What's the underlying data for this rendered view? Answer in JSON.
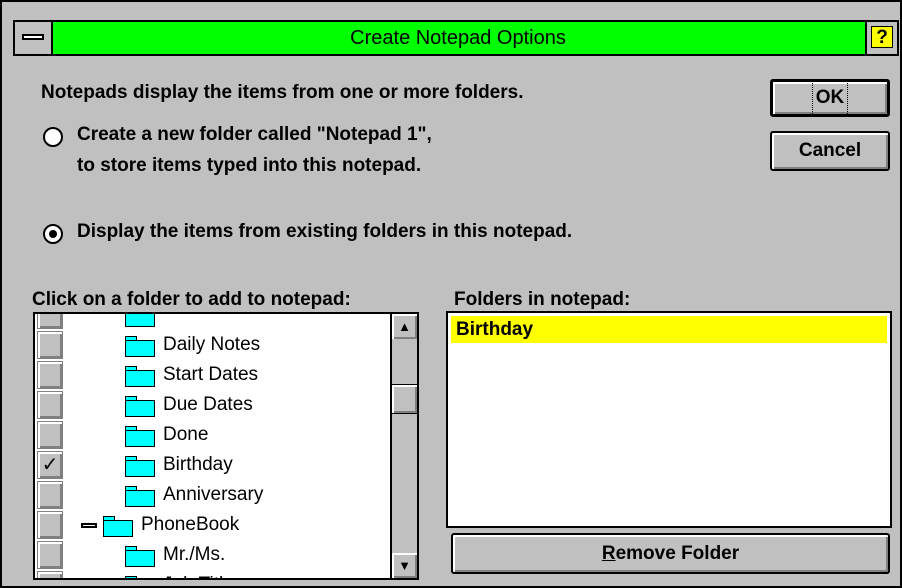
{
  "dialog": {
    "title": "Create Notepad Options",
    "help_label": "?",
    "intro": "Notepads display the items from one or more folders.",
    "option_new_line1": "Create a new folder called \"Notepad 1\",",
    "option_new_line2": "to store items typed into this notepad.",
    "option_existing": "Display the items from existing folders in this notepad.",
    "selected_option": "existing",
    "ok_label": "OK",
    "cancel_label": "Cancel"
  },
  "tree": {
    "header": "Click on a folder to add to notepad:",
    "items": [
      {
        "label": "",
        "checked": false,
        "icon": "folder-icon"
      },
      {
        "label": "Daily Notes",
        "checked": false,
        "icon": "folder-icon"
      },
      {
        "label": "Start Dates",
        "checked": false,
        "icon": "folder-icon"
      },
      {
        "label": "Due Dates",
        "checked": false,
        "icon": "folder-icon"
      },
      {
        "label": "Done",
        "checked": false,
        "icon": "folder-icon"
      },
      {
        "label": "Birthday",
        "checked": true,
        "check_mark": "✓",
        "icon": "folder-icon"
      },
      {
        "label": "Anniversary",
        "checked": false,
        "icon": "folder-icon"
      },
      {
        "label": "PhoneBook",
        "checked": false,
        "icon": "folder-icon",
        "collapsible": true
      },
      {
        "label": "Mr./Ms.",
        "checked": false,
        "icon": "folder-icon"
      },
      {
        "label": "Job Title",
        "checked": false,
        "icon": "folder-icon"
      }
    ],
    "scroll_up": "▲",
    "scroll_down": "▼"
  },
  "notepad": {
    "header": "Folders in notepad:",
    "folders": [
      "Birthday"
    ],
    "remove_accel": "R",
    "remove_rest": "emove Folder"
  },
  "colors": {
    "title_bar": "#00ff00",
    "help_button": "#ffff00",
    "selection": "#ffff00",
    "folder_icon": "#00ffff",
    "dialog_bg": "#c0c0c0"
  }
}
